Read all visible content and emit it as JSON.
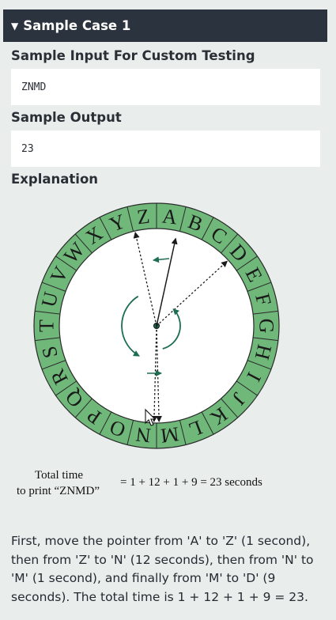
{
  "sample_case": {
    "toggle_icon": "triangle-down-icon",
    "title": "Sample Case 1"
  },
  "input_section": {
    "label": "Sample Input For Custom Testing",
    "value": "ZNMD"
  },
  "output_section": {
    "label": "Sample Output",
    "value": "23"
  },
  "explanation": {
    "label": "Explanation",
    "wheel_letters": [
      "A",
      "B",
      "C",
      "D",
      "E",
      "F",
      "G",
      "H",
      "I",
      "J",
      "K",
      "L",
      "M",
      "N",
      "O",
      "P",
      "Q",
      "R",
      "S",
      "T",
      "U",
      "V",
      "W",
      "X",
      "Y",
      "Z"
    ],
    "caption_line1": "Total time",
    "caption_line2": "to print “ZNMD”",
    "equation": "= 1 + 12 + 1 + 9 = 23 seconds",
    "text": "First, move the pointer from 'A' to 'Z' (1 second), then from 'Z' to 'N' (12 seconds), then from 'N' to 'M' (1 second), and finally from 'M' to 'D' (9 seconds). The total time is 1 + 12 + 1 + 9 = 23.",
    "colors": {
      "ring": "#6fb87a",
      "arrow": "#1d6d55"
    }
  }
}
